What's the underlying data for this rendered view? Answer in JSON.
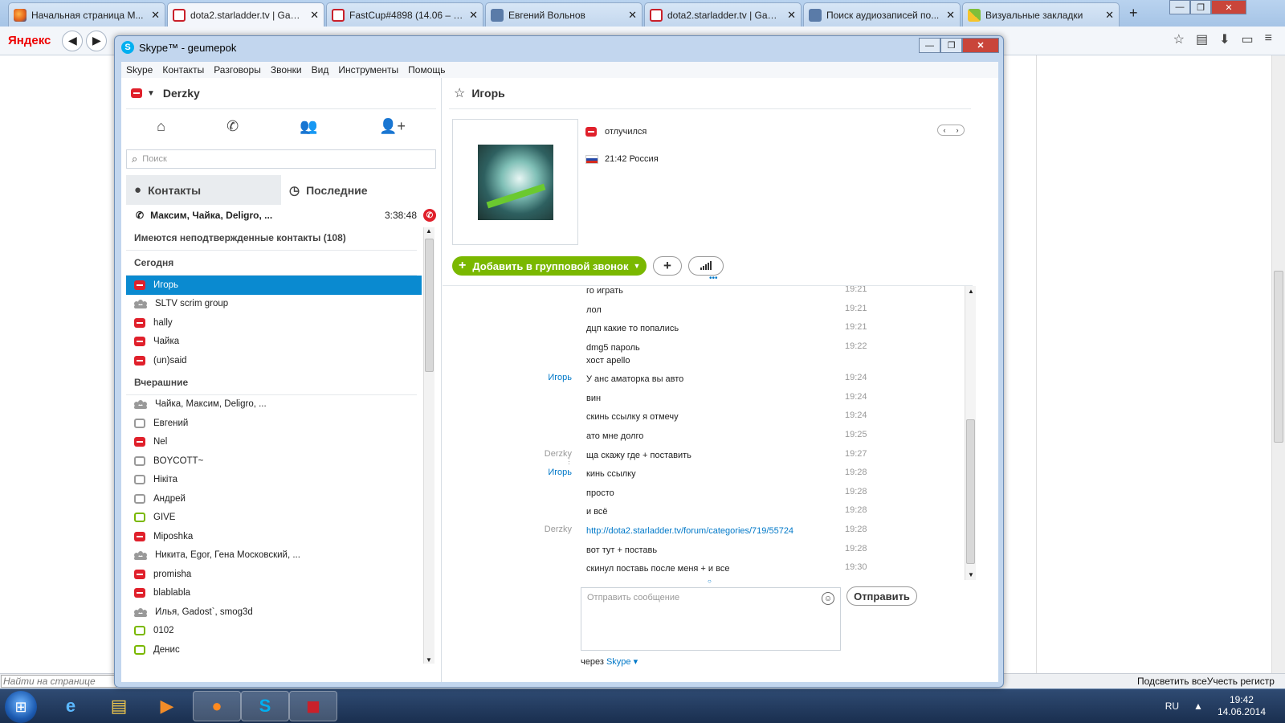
{
  "browser": {
    "tabs": [
      {
        "title": "Начальная страница M...",
        "icon": "firefox-icon"
      },
      {
        "title": "dota2.starladder.tv | Gam...",
        "icon": "starladder-icon",
        "active": true
      },
      {
        "title": "FastCup#4898 (14.06 – 14...",
        "icon": "starladder-icon"
      },
      {
        "title": "Евгений Вольнов",
        "icon": "vk-icon"
      },
      {
        "title": "dota2.starladder.tv | Gam...",
        "icon": "starladder-icon"
      },
      {
        "title": "Поиск аудиозаписей по...",
        "icon": "vk-icon"
      },
      {
        "title": "Визуальные закладки",
        "icon": "bookmarks-icon"
      }
    ],
    "new_tab": "+",
    "brand": "Яндекс",
    "find_placeholder": "Найти на странице",
    "find_right": "Подсветить всеУчесть регистр"
  },
  "taskbar": {
    "lang": "RU",
    "time": "19:42",
    "date": "14.06.2014"
  },
  "skype": {
    "title": "Skype™ - geumepok",
    "menu": [
      "Skype",
      "Контакты",
      "Разговоры",
      "Звонки",
      "Вид",
      "Инструменты",
      "Помощь"
    ],
    "user": "Derzky",
    "search_placeholder": "Поиск",
    "tab_contacts": "Контакты",
    "tab_recent": "Последние",
    "active_call": {
      "names": "Максим, Чайка, Deligro, ...",
      "duration": "3:38:48"
    },
    "unconfirmed": "Имеются неподтвержденные контакты (108)",
    "section_today": "Сегодня",
    "today": [
      {
        "name": "Игорь",
        "status": "away",
        "selected": true
      },
      {
        "name": "SLTV scrim group",
        "status": "group"
      },
      {
        "name": "hally",
        "status": "away"
      },
      {
        "name": "Чайка",
        "status": "away"
      },
      {
        "name": "(un)said",
        "status": "away"
      }
    ],
    "section_yesterday": "Вчерашние",
    "yesterday": [
      {
        "name": "Чайка, Максим, Deligro, ...",
        "status": "group"
      },
      {
        "name": "Евгений",
        "status": "unknown"
      },
      {
        "name": "Nel",
        "status": "away"
      },
      {
        "name": "BOYCOTT~",
        "status": "unknown"
      },
      {
        "name": "Нікіта",
        "status": "unknown"
      },
      {
        "name": "Андрей",
        "status": "unknown"
      },
      {
        "name": "GIVE",
        "status": "offline"
      },
      {
        "name": "Miposhka",
        "status": "away"
      },
      {
        "name": "Никита, Egor, Гена Московский, ...",
        "status": "group"
      },
      {
        "name": "promisha",
        "status": "away"
      },
      {
        "name": "blablabla",
        "status": "away"
      },
      {
        "name": "Илья, Gadost`, smog3d",
        "status": "group"
      },
      {
        "name": "0102",
        "status": "offline"
      },
      {
        "name": "Денис",
        "status": "offline"
      }
    ],
    "chat": {
      "contact": "Игорь",
      "status_text": "отлучился",
      "location": "21:42 Россия",
      "add_group_call": "Добавить в групповой звонок",
      "messages": [
        {
          "who": "",
          "text": "го играть",
          "time": "19:21"
        },
        {
          "who": "",
          "text": "лол",
          "time": "19:21"
        },
        {
          "who": "",
          "text": "дцп какие то попались",
          "time": "19:21"
        },
        {
          "who": "",
          "text": "dmg5 пароль",
          "text2": "хост apello",
          "time": "19:22"
        },
        {
          "who": "Игорь",
          "text": "У анс аматорка вы авто",
          "time": "19:24"
        },
        {
          "who": "",
          "text": "вин",
          "time": "19:24"
        },
        {
          "who": "",
          "text": "скинь ссылку я отмечу",
          "time": "19:24"
        },
        {
          "who": "",
          "text": "ато мне долго",
          "time": "19:25"
        },
        {
          "who": "Derzky",
          "text": "ща скажу где + поставить",
          "time": "19:27"
        },
        {
          "who": "Игорь",
          "text": "кинь ссылку",
          "time": "19:28"
        },
        {
          "who": "",
          "text": "просто",
          "time": "19:28"
        },
        {
          "who": "",
          "text": "и всё",
          "time": "19:28"
        },
        {
          "who": "Derzky",
          "text": "http://dota2.starladder.tv/forum/categories/719/55724",
          "link": true,
          "time": "19:28"
        },
        {
          "who": "",
          "text": "вот тут + поставь",
          "time": "19:28"
        },
        {
          "who": "",
          "text": "скинул поставь после меня + и все",
          "time": "19:30"
        }
      ],
      "compose_placeholder": "Отправить сообщение",
      "send": "Отправить",
      "via_prefix": "через",
      "via_service": "Skype"
    }
  }
}
